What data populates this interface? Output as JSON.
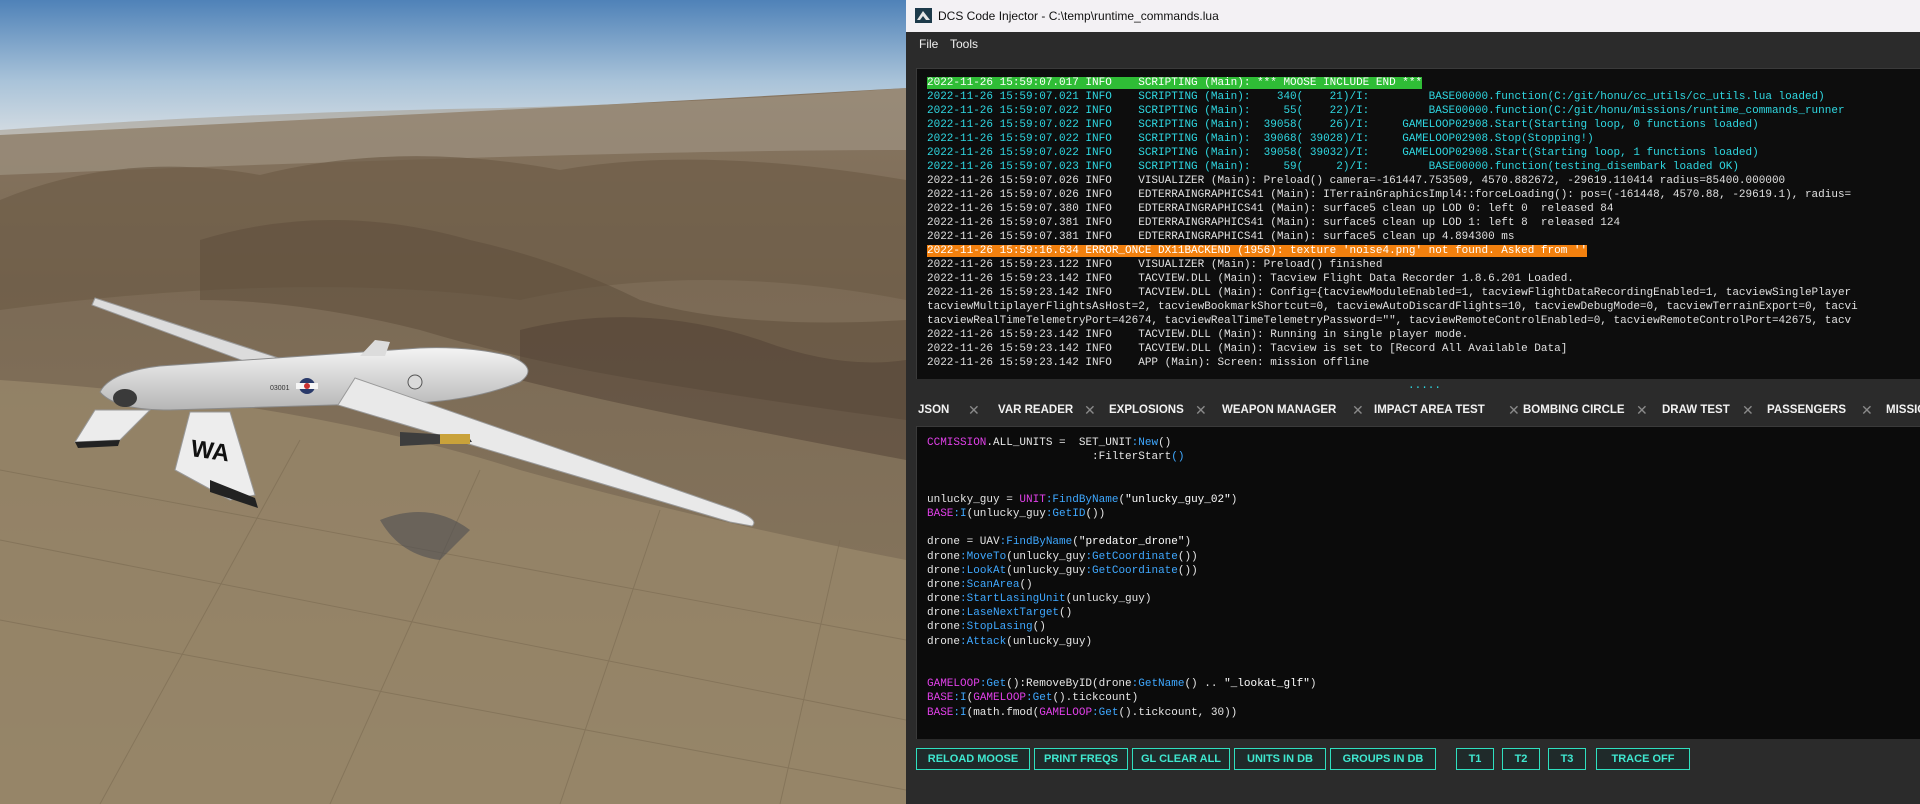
{
  "window": {
    "title": "DCS Code Injector - C:\\temp\\runtime_commands.lua",
    "app_icon": "dcs-code-injector-icon"
  },
  "menu": [
    "File",
    "Tools"
  ],
  "scene": {
    "tail_code": "WA",
    "serial": "03001"
  },
  "log": {
    "lines": [
      {
        "text": "2022-11-26 15:59:07.017 INFO    SCRIPTING (Main): *** MOOSE INCLUDE END ***",
        "style": "hl-green"
      },
      {
        "text": "2022-11-26 15:59:07.021 INFO    SCRIPTING (Main):    340(    21)/I:         BASE00000.function(C:/git/honu/cc_utils/cc_utils.lua loaded)",
        "style": "cyan"
      },
      {
        "text": "2022-11-26 15:59:07.022 INFO    SCRIPTING (Main):     55(    22)/I:         BASE00000.function(C:/git/honu/missions/runtime_commands_runner",
        "style": "cyan"
      },
      {
        "text": "2022-11-26 15:59:07.022 INFO    SCRIPTING (Main):  39058(    26)/I:     GAMELOOP02908.Start(Starting loop, 0 functions loaded)",
        "style": "cyan"
      },
      {
        "text": "2022-11-26 15:59:07.022 INFO    SCRIPTING (Main):  39068( 39028)/I:     GAMELOOP02908.Stop(Stopping!)",
        "style": "cyan"
      },
      {
        "text": "2022-11-26 15:59:07.022 INFO    SCRIPTING (Main):  39058( 39032)/I:     GAMELOOP02908.Start(Starting loop, 1 functions loaded)",
        "style": "cyan"
      },
      {
        "text": "2022-11-26 15:59:07.023 INFO    SCRIPTING (Main):     59(     2)/I:         BASE00000.function(testing_disembark loaded OK)",
        "style": "cyan"
      },
      {
        "text": "2022-11-26 15:59:07.026 INFO    VISUALIZER (Main): Preload() camera=-161447.753509, 4570.882672, -29619.110414 radius=85400.000000",
        "style": "info"
      },
      {
        "text": "2022-11-26 15:59:07.026 INFO    EDTERRAINGRAPHICS41 (Main): ITerrainGraphicsImpl4::forceLoading(): pos=(-161448, 4570.88, -29619.1), radius=",
        "style": "info"
      },
      {
        "text": "2022-11-26 15:59:07.380 INFO    EDTERRAINGRAPHICS41 (Main): surface5 clean up LOD 0: left 0  released 84",
        "style": "info"
      },
      {
        "text": "2022-11-26 15:59:07.381 INFO    EDTERRAINGRAPHICS41 (Main): surface5 clean up LOD 1: left 8  released 124",
        "style": "info"
      },
      {
        "text": "2022-11-26 15:59:07.381 INFO    EDTERRAINGRAPHICS41 (Main): surface5 clean up 4.894300 ms",
        "style": "info"
      },
      {
        "text": "2022-11-26 15:59:16.634 ERROR_ONCE DX11BACKEND (1956): texture 'noise4.png' not found. Asked from ''",
        "style": "hl-orange"
      },
      {
        "text": "2022-11-26 15:59:23.122 INFO    VISUALIZER (Main): Preload() finished",
        "style": "info"
      },
      {
        "text": "2022-11-26 15:59:23.142 INFO    TACVIEW.DLL (Main): Tacview Flight Data Recorder 1.8.6.201 Loaded.",
        "style": "info"
      },
      {
        "text": "2022-11-26 15:59:23.142 INFO    TACVIEW.DLL (Main): Config={tacviewModuleEnabled=1, tacviewFlightDataRecordingEnabled=1, tacviewSinglePlayer",
        "style": "info"
      },
      {
        "text": "tacviewMultiplayerFlightsAsHost=2, tacviewBookmarkShortcut=0, tacviewAutoDiscardFlights=10, tacviewDebugMode=0, tacviewTerrainExport=0, tacvi",
        "style": "info"
      },
      {
        "text": "tacviewRealTimeTelemetryPort=42674, tacviewRealTimeTelemetryPassword=\"\", tacviewRemoteControlEnabled=0, tacviewRemoteControlPort=42675, tacv",
        "style": "info"
      },
      {
        "text": "2022-11-26 15:59:23.142 INFO    TACVIEW.DLL (Main): Running in single player mode.",
        "style": "info"
      },
      {
        "text": "2022-11-26 15:59:23.142 INFO    TACVIEW.DLL (Main): Tacview is set to [Record All Available Data]",
        "style": "info"
      },
      {
        "text": "2022-11-26 15:59:23.142 INFO    APP (Main): Screen: mission offline",
        "style": "info"
      }
    ]
  },
  "splitter_handle": ".....",
  "tabs": [
    "JSON",
    "VAR READER",
    "EXPLOSIONS",
    "WEAPON MANAGER",
    "IMPACT AREA TEST",
    "BOMBING CIRCLE",
    "DRAW TEST",
    "PASSENGERS",
    "MISSIO"
  ],
  "editor": {
    "lines": [
      [
        [
          "kw",
          "CCMISSION"
        ],
        [
          "",
          "."
        ],
        [
          "",
          "ALL_UNITS =  SET_UNIT"
        ],
        [
          "fn",
          ":New"
        ],
        [
          "",
          "()"
        ]
      ],
      [
        [
          "",
          "                         "
        ],
        [
          "",
          ":FilterStart"
        ],
        [
          "fn",
          "()"
        ]
      ],
      [],
      [],
      [
        [
          "",
          "unlucky_guy = "
        ],
        [
          "kw",
          "UNIT"
        ],
        [
          "fn",
          ":FindByName"
        ],
        [
          "",
          "("
        ],
        [
          "st",
          "\"unlucky_guy_02\""
        ],
        [
          "",
          ")"
        ]
      ],
      [
        [
          "kw",
          "BASE"
        ],
        [
          "fn",
          ":I"
        ],
        [
          "",
          "(unlucky_guy"
        ],
        [
          "fn",
          ":GetID"
        ],
        [
          "",
          "())"
        ]
      ],
      [],
      [
        [
          "",
          "drone = UAV"
        ],
        [
          "fn",
          ":FindByName"
        ],
        [
          "",
          "("
        ],
        [
          "st",
          "\"predator_drone\""
        ],
        [
          "",
          ")"
        ]
      ],
      [
        [
          "",
          "drone"
        ],
        [
          "fn",
          ":MoveTo"
        ],
        [
          "",
          "(unlucky_guy"
        ],
        [
          "fn",
          ":GetCoordinate"
        ],
        [
          "",
          "())"
        ]
      ],
      [
        [
          "",
          "drone"
        ],
        [
          "fn",
          ":LookAt"
        ],
        [
          "",
          "(unlucky_guy"
        ],
        [
          "fn",
          ":GetCoordinate"
        ],
        [
          "",
          "())"
        ]
      ],
      [
        [
          "",
          "drone"
        ],
        [
          "fn",
          ":ScanArea"
        ],
        [
          "",
          "()"
        ]
      ],
      [
        [
          "",
          "drone"
        ],
        [
          "fn",
          ":StartLasingUnit"
        ],
        [
          "",
          "(unlucky_guy)"
        ]
      ],
      [
        [
          "",
          "drone"
        ],
        [
          "fn",
          ":LaseNextTarget"
        ],
        [
          "",
          "()"
        ]
      ],
      [
        [
          "",
          "drone"
        ],
        [
          "fn",
          ":StopLasing"
        ],
        [
          "",
          "()"
        ]
      ],
      [
        [
          "",
          "drone"
        ],
        [
          "fn",
          ":Attack"
        ],
        [
          "",
          "(unlucky_guy)"
        ]
      ],
      [],
      [],
      [
        [
          "kw",
          "GAMELOOP"
        ],
        [
          "fn",
          ":Get"
        ],
        [
          "",
          "():RemoveByID(drone"
        ],
        [
          "fn",
          ":GetName"
        ],
        [
          "",
          "() .. "
        ],
        [
          "st",
          "\"_lookat_glf\""
        ],
        [
          "",
          ")"
        ]
      ],
      [
        [
          "kw",
          "BASE"
        ],
        [
          "fn",
          ":I"
        ],
        [
          "",
          "("
        ],
        [
          "kw",
          "GAMELOOP"
        ],
        [
          "fn",
          ":Get"
        ],
        [
          "",
          "().tickcount)"
        ]
      ],
      [
        [
          "kw",
          "BASE"
        ],
        [
          "fn",
          ":I"
        ],
        [
          "",
          "(math.fmod("
        ],
        [
          "kw",
          "GAMELOOP"
        ],
        [
          "fn",
          ":Get"
        ],
        [
          "",
          "().tickcount, 30))"
        ]
      ]
    ]
  },
  "buttons": [
    "RELOAD MOOSE",
    "PRINT FREQS",
    "GL CLEAR  ALL",
    "UNITS IN DB",
    "GROUPS IN DB",
    "T1",
    "T2",
    "T3",
    "TRACE OFF"
  ],
  "colors": {
    "accent": "#2fe0c0",
    "log_info_cyan": "#2fd8e2",
    "highlight_green": "#2fbd36",
    "highlight_orange": "#f2800e",
    "keyword_magenta": "#e040e8",
    "function_blue": "#3fa8ff"
  }
}
